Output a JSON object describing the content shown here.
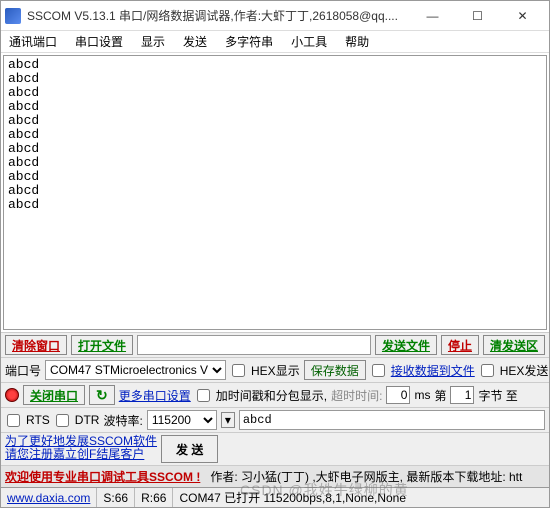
{
  "title": "SSCOM V5.13.1 串口/网络数据调试器,作者:大虾丁丁,2618058@qq....",
  "menu": [
    "通讯端口",
    "串口设置",
    "显示",
    "发送",
    "多字符串",
    "小工具",
    "帮助"
  ],
  "rx_text": "abcd\nabcd\nabcd\nabcd\nabcd\nabcd\nabcd\nabcd\nabcd\nabcd\nabcd",
  "row1": {
    "clear": "清除窗口",
    "open_file": "打开文件",
    "send_file": "发送文件",
    "stop": "停止",
    "clear_send": "清发送区"
  },
  "row2": {
    "port_label": "端口号",
    "port_value": "COM47 STMicroelectronics V",
    "hex_show": "HEX显示",
    "save_data": "保存数据",
    "rx_to_file": "接收数据到文件",
    "hex_send": "HEX发送"
  },
  "row3": {
    "close_port": "关闭串口",
    "more_settings": "更多串口设置",
    "timestamp_pkt": "加时间戳和分包显示,",
    "timeout_label": "超时时间:",
    "timeout_val": "0",
    "ms": "ms",
    "seg1_label": "第",
    "seg1_val": "1",
    "seg2_label": "字节 至"
  },
  "row4": {
    "rts": "RTS",
    "dtr": "DTR",
    "baud_label": "波特率:",
    "baud_value": "115200",
    "send_content": "abcd"
  },
  "row5": {
    "line1": "为了更好地发展SSCOM软件",
    "line2": "请您注册嘉立创F结尾客户",
    "send_btn": "发    送"
  },
  "row6": {
    "welcome": "欢迎使用专业串口调试工具SSCOM !",
    "author": "作者: 习小猛(丁丁) ,大虾电子网版主,  最新版本下载地址:  htt"
  },
  "status": {
    "site": "www.daxia.com",
    "s_label": "S:",
    "s_val": "66",
    "r_label": "R:",
    "r_val": "66",
    "com_info": "COM47 已打开 115200bps,8,1,None,None"
  },
  "watermark": "CSDN @我姓牛绿柳的黄"
}
